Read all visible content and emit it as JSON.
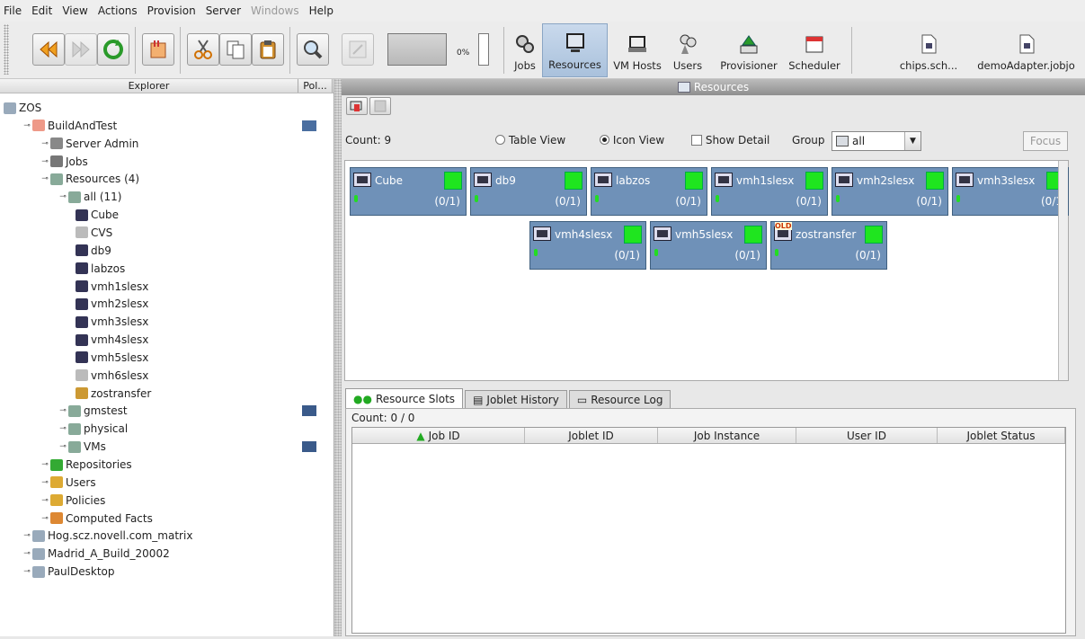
{
  "menu": [
    "File",
    "Edit",
    "View",
    "Actions",
    "Provision",
    "Server",
    "Windows",
    "Help"
  ],
  "toolbar": {
    "progress_label": "0%",
    "views": [
      {
        "label": "Jobs",
        "icon": "jobs-icon"
      },
      {
        "label": "Resources",
        "icon": "resources-icon"
      },
      {
        "label": "VM Hosts",
        "icon": "vmhosts-icon"
      },
      {
        "label": "Users",
        "icon": "users-icon"
      },
      {
        "label": "Provisioner",
        "icon": "provisioner-icon"
      },
      {
        "label": "Scheduler",
        "icon": "scheduler-icon"
      }
    ],
    "files": [
      "chips.sch...",
      "demoAdapter.jobjo"
    ]
  },
  "explorer": {
    "col_explorer": "Explorer",
    "col_policy": "Pol...",
    "tree": [
      {
        "label": "ZOS",
        "indent": 0,
        "icon": "grid-icon"
      },
      {
        "label": "BuildAndTest",
        "indent": 1,
        "icon": "server-icon",
        "policy": true
      },
      {
        "label": "Server Admin",
        "indent": 2,
        "icon": "admin-icon"
      },
      {
        "label": "Jobs",
        "indent": 2,
        "icon": "jobs-icon"
      },
      {
        "label": "Resources (4)",
        "indent": 2,
        "icon": "resources-icon"
      },
      {
        "label": "all (11)",
        "indent": 3,
        "icon": "resources-icon"
      },
      {
        "label": "Cube",
        "indent": 4,
        "icon": "machine-icon"
      },
      {
        "label": "CVS",
        "indent": 4,
        "icon": "machine-off-icon"
      },
      {
        "label": "db9",
        "indent": 4,
        "icon": "machine-icon"
      },
      {
        "label": "labzos",
        "indent": 4,
        "icon": "machine-icon"
      },
      {
        "label": "vmh1slesx",
        "indent": 4,
        "icon": "machine-icon"
      },
      {
        "label": "vmh2slesx",
        "indent": 4,
        "icon": "machine-icon"
      },
      {
        "label": "vmh3slesx",
        "indent": 4,
        "icon": "machine-icon"
      },
      {
        "label": "vmh4slesx",
        "indent": 4,
        "icon": "machine-icon"
      },
      {
        "label": "vmh5slesx",
        "indent": 4,
        "icon": "machine-icon"
      },
      {
        "label": "vmh6slesx",
        "indent": 4,
        "icon": "machine-off-icon"
      },
      {
        "label": "zostransfer",
        "indent": 4,
        "icon": "old-machine-icon"
      },
      {
        "label": "gmstest",
        "indent": 3,
        "icon": "resources-icon",
        "policy": true
      },
      {
        "label": "physical",
        "indent": 3,
        "icon": "resources-icon"
      },
      {
        "label": "VMs",
        "indent": 3,
        "icon": "resources-icon",
        "policy": true
      },
      {
        "label": "Repositories",
        "indent": 2,
        "icon": "repo-icon"
      },
      {
        "label": "Users",
        "indent": 2,
        "icon": "users-icon"
      },
      {
        "label": "Policies",
        "indent": 2,
        "icon": "policies-icon"
      },
      {
        "label": "Computed Facts",
        "indent": 2,
        "icon": "facts-icon"
      },
      {
        "label": "Hog.scz.novell.com_matrix",
        "indent": 1,
        "icon": "grid-icon"
      },
      {
        "label": "Madrid_A_Build_20002",
        "indent": 1,
        "icon": "grid-icon"
      },
      {
        "label": "PaulDesktop",
        "indent": 1,
        "icon": "grid-icon"
      }
    ]
  },
  "resources_panel": {
    "title": "Resources",
    "count": "Count: 9",
    "table_view": "Table View",
    "icon_view": "Icon View",
    "show_detail": "Show Detail",
    "group_label": "Group",
    "group_value": "all",
    "focus": "Focus",
    "cards_row1": [
      {
        "name": "Cube",
        "slots": "(0/1)"
      },
      {
        "name": "db9",
        "slots": "(0/1)"
      },
      {
        "name": "labzos",
        "slots": "(0/1)"
      },
      {
        "name": "vmh1slesx",
        "slots": "(0/1)"
      },
      {
        "name": "vmh2slesx",
        "slots": "(0/1)"
      },
      {
        "name": "vmh3slesx",
        "slots": "(0/1"
      }
    ],
    "cards_row2": [
      {
        "name": "vmh4slesx",
        "slots": "(0/1)"
      },
      {
        "name": "vmh5slesx",
        "slots": "(0/1)"
      },
      {
        "name": "zostransfer",
        "slots": "(0/1)",
        "old": "OLD"
      }
    ]
  },
  "slots": {
    "tabs": [
      "Resource Slots",
      "Joblet History",
      "Resource Log"
    ],
    "count": "Count: 0 / 0",
    "columns": [
      "Job ID",
      "Joblet ID",
      "Job Instance",
      "User ID",
      "Joblet Status"
    ]
  }
}
